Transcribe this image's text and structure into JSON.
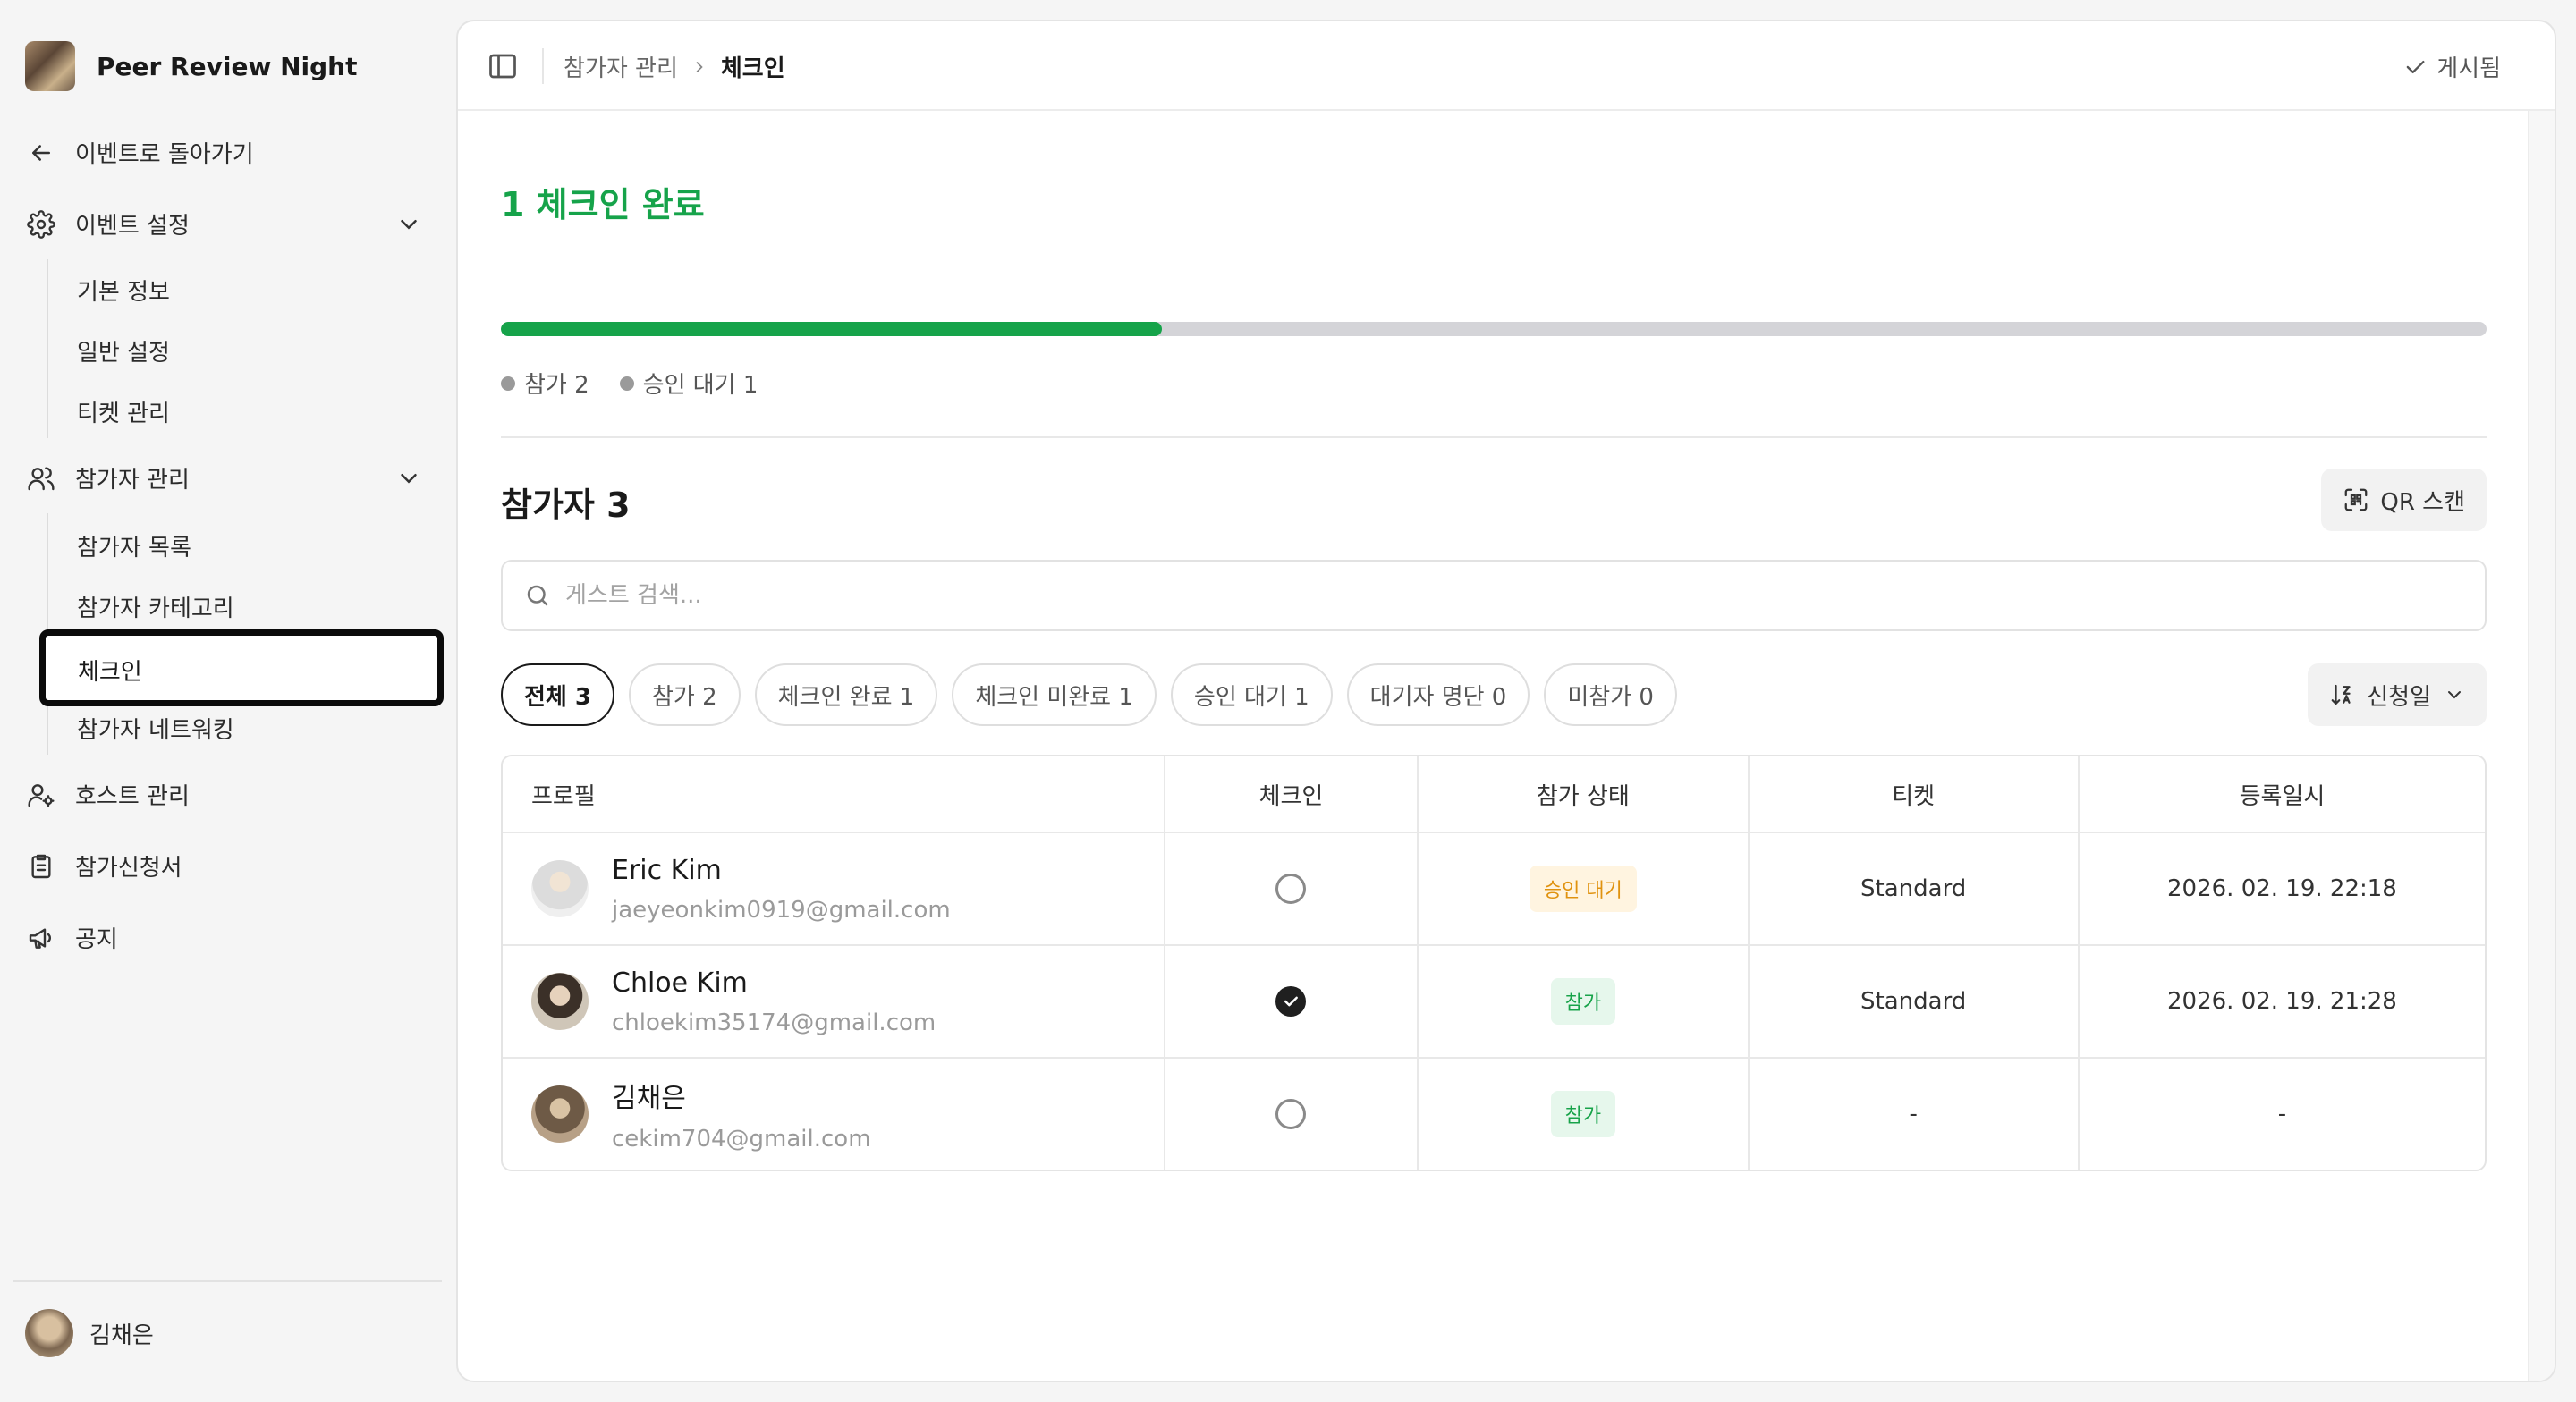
{
  "sidebar": {
    "event_name": "Peer Review Night",
    "back_label": "이벤트로 돌아가기",
    "event_settings": {
      "label": "이벤트 설정",
      "items": [
        "기본 정보",
        "일반 설정",
        "티켓 관리"
      ]
    },
    "participant_mgmt": {
      "label": "참가자 관리",
      "items": [
        "참가자 목록",
        "참가자 카테고리",
        "체크인",
        "참가자 네트워킹"
      ]
    },
    "host_mgmt": "호스트 관리",
    "applications": "참가신청서",
    "notice": "공지",
    "user_name": "김채은"
  },
  "topbar": {
    "crumb_parent": "참가자 관리",
    "crumb_current": "체크인",
    "status": "게시됨"
  },
  "checkin": {
    "title": "1 체크인 완료",
    "progress_fraction": 0.333,
    "legend": [
      "참가 2",
      "승인 대기 1"
    ]
  },
  "participants": {
    "title": "참가자 3",
    "qr_label": "QR 스캔",
    "search_placeholder": "게스트 검색...",
    "filters": [
      "전체 3",
      "참가 2",
      "체크인 완료 1",
      "체크인 미완료 1",
      "승인 대기 1",
      "대기자 명단 0",
      "미참가 0"
    ],
    "active_filter": "전체 3",
    "sort_label": "신청일"
  },
  "table": {
    "headers": [
      "프로필",
      "체크인",
      "참가 상태",
      "티켓",
      "등록일시"
    ],
    "rows": [
      {
        "name": "Eric Kim",
        "email": "jaeyeonkim0919@gmail.com",
        "checked_in": false,
        "status": "승인 대기",
        "ticket": "Standard",
        "registered": "2026. 02. 19. 22:18"
      },
      {
        "name": "Chloe Kim",
        "email": "chloekim35174@gmail.com",
        "checked_in": true,
        "status": "참가",
        "ticket": "Standard",
        "registered": "2026. 02. 19. 21:28"
      },
      {
        "name": "김채은",
        "email": "cekim704@gmail.com",
        "checked_in": false,
        "status": "참가",
        "ticket": "-",
        "registered": "-"
      }
    ]
  },
  "colors": {
    "accent_green": "#16a34a",
    "pending_orange": "#e0920f"
  }
}
